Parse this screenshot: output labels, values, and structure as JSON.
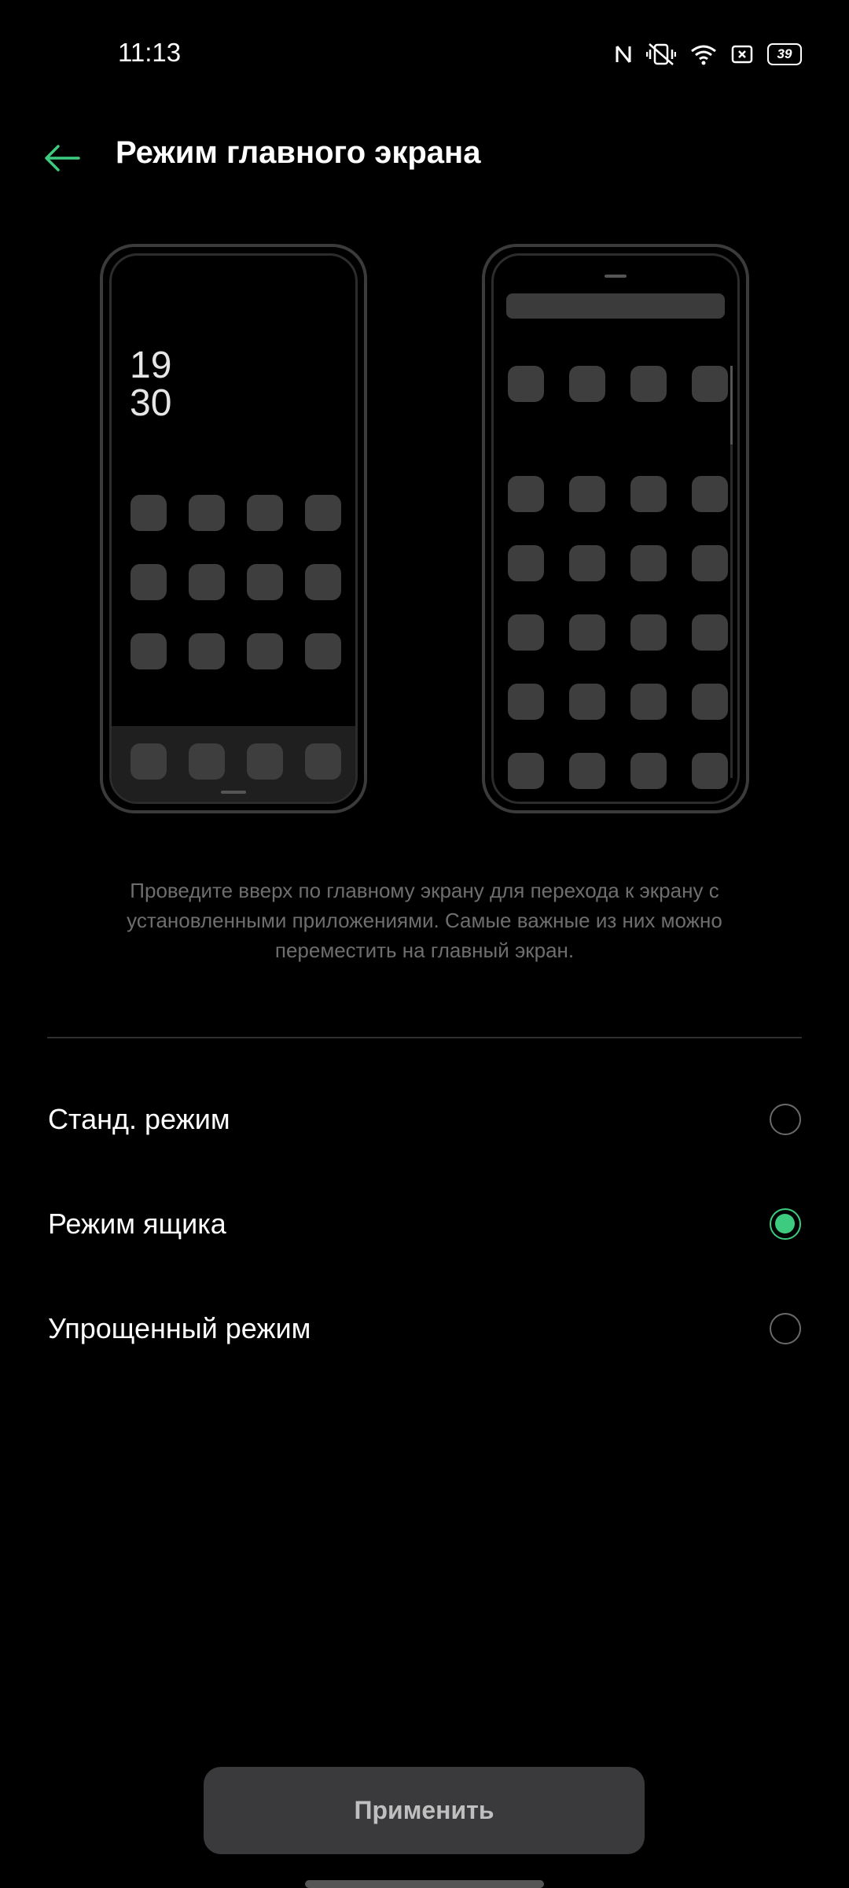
{
  "status_bar": {
    "time": "11:13",
    "battery": "39",
    "icons": [
      "nfc-icon",
      "vibrate-off-icon",
      "wifi-icon",
      "sim-icon",
      "battery-icon"
    ]
  },
  "header": {
    "title": "Режим главного экрана",
    "back_icon": "arrow-left-icon"
  },
  "preview": {
    "clock_hours": "19",
    "clock_minutes": "30"
  },
  "description": "Проведите вверх по главному экрану для перехода к экрану с установленными приложениями. Самые важные из них можно переместить на главный экран.",
  "options": [
    {
      "label": "Станд. режим",
      "selected": false
    },
    {
      "label": "Режим ящика",
      "selected": true
    },
    {
      "label": "Упрощенный режим",
      "selected": false
    }
  ],
  "apply_button": "Применить",
  "colors": {
    "accent": "#3ccb7f",
    "background": "#000000",
    "button": "#3a3a3c"
  }
}
